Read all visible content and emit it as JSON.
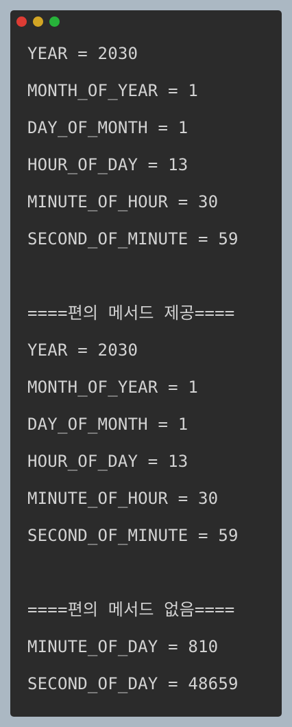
{
  "window": {
    "traffic_lights": [
      {
        "name": "close",
        "color": "#dd3c34"
      },
      {
        "name": "minimize",
        "color": "#d2a524"
      },
      {
        "name": "maximize",
        "color": "#27b33a"
      }
    ]
  },
  "console": {
    "lines": [
      "YEAR = 2030",
      "MONTH_OF_YEAR = 1",
      "DAY_OF_MONTH = 1",
      "HOUR_OF_DAY = 13",
      "MINUTE_OF_HOUR = 30",
      "SECOND_OF_MINUTE = 59",
      "",
      "====편의 메서드 제공====",
      "YEAR = 2030",
      "MONTH_OF_YEAR = 1",
      "DAY_OF_MONTH = 1",
      "HOUR_OF_DAY = 13",
      "MINUTE_OF_HOUR = 30",
      "SECOND_OF_MINUTE = 59",
      "",
      "====편의 메서드 없음====",
      "MINUTE_OF_DAY = 810",
      "SECOND_OF_DAY = 48659"
    ]
  }
}
